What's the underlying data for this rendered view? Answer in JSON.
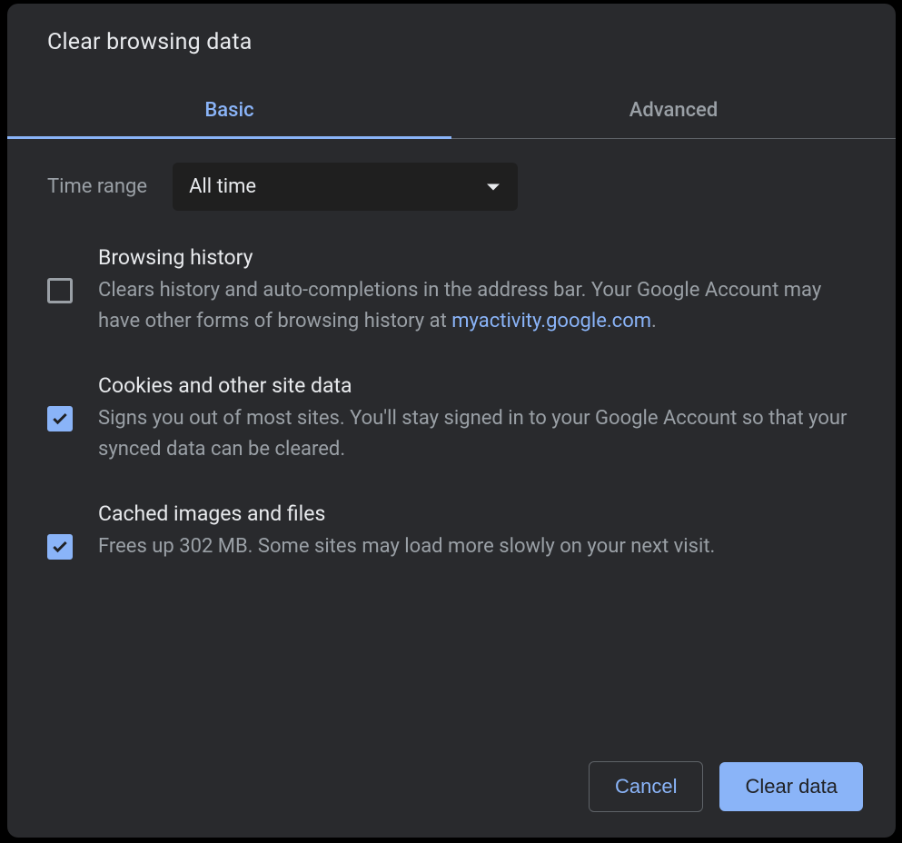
{
  "dialog": {
    "title": "Clear browsing data"
  },
  "tabs": {
    "basic": "Basic",
    "advanced": "Advanced"
  },
  "timeRange": {
    "label": "Time range",
    "selected": "All time"
  },
  "options": {
    "browsingHistory": {
      "title": "Browsing history",
      "descPre": "Clears history and auto-completions in the address bar. Your Google Account may have other forms of browsing history at ",
      "link": "myactivity.google.com",
      "descPost": ".",
      "checked": false
    },
    "cookies": {
      "title": "Cookies and other site data",
      "desc": "Signs you out of most sites. You'll stay signed in to your Google Account so that your synced data can be cleared.",
      "checked": true
    },
    "cache": {
      "title": "Cached images and files",
      "desc": "Frees up 302 MB. Some sites may load more slowly on your next visit.",
      "checked": true
    }
  },
  "buttons": {
    "cancel": "Cancel",
    "clearData": "Clear data"
  }
}
